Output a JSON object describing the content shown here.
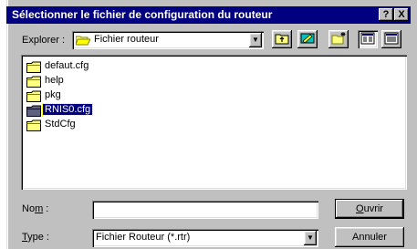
{
  "dialog": {
    "title": "Sélectionner le fichier de configuration du routeur",
    "help_button": "?",
    "close_button": "X"
  },
  "toolbar": {
    "look_in_label": "Explorer :",
    "look_in_value": "Fichier routeur",
    "tools": [
      "up-one-level-icon",
      "desktop-icon",
      "new-folder-icon",
      "list-view-icon",
      "details-view-icon"
    ]
  },
  "file_list": {
    "items": [
      {
        "name": "defaut.cfg",
        "icon": "folder-icon",
        "selected": false
      },
      {
        "name": "help",
        "icon": "folder-icon",
        "selected": false
      },
      {
        "name": "pkg",
        "icon": "folder-icon",
        "selected": false
      },
      {
        "name": "RNIS0.cfg",
        "icon": "folder-icon",
        "selected": true
      },
      {
        "name": "StdCfg",
        "icon": "folder-icon",
        "selected": false
      }
    ]
  },
  "form": {
    "name_label_pre": "No",
    "name_label_acc": "m",
    "name_label_post": " :",
    "name_value": "",
    "type_label_acc": "T",
    "type_label_post": "ype :",
    "type_value": "Fichier Routeur (*.rtr)"
  },
  "buttons": {
    "open_acc": "O",
    "open_rest": "uvrir",
    "cancel": "Annuler"
  }
}
